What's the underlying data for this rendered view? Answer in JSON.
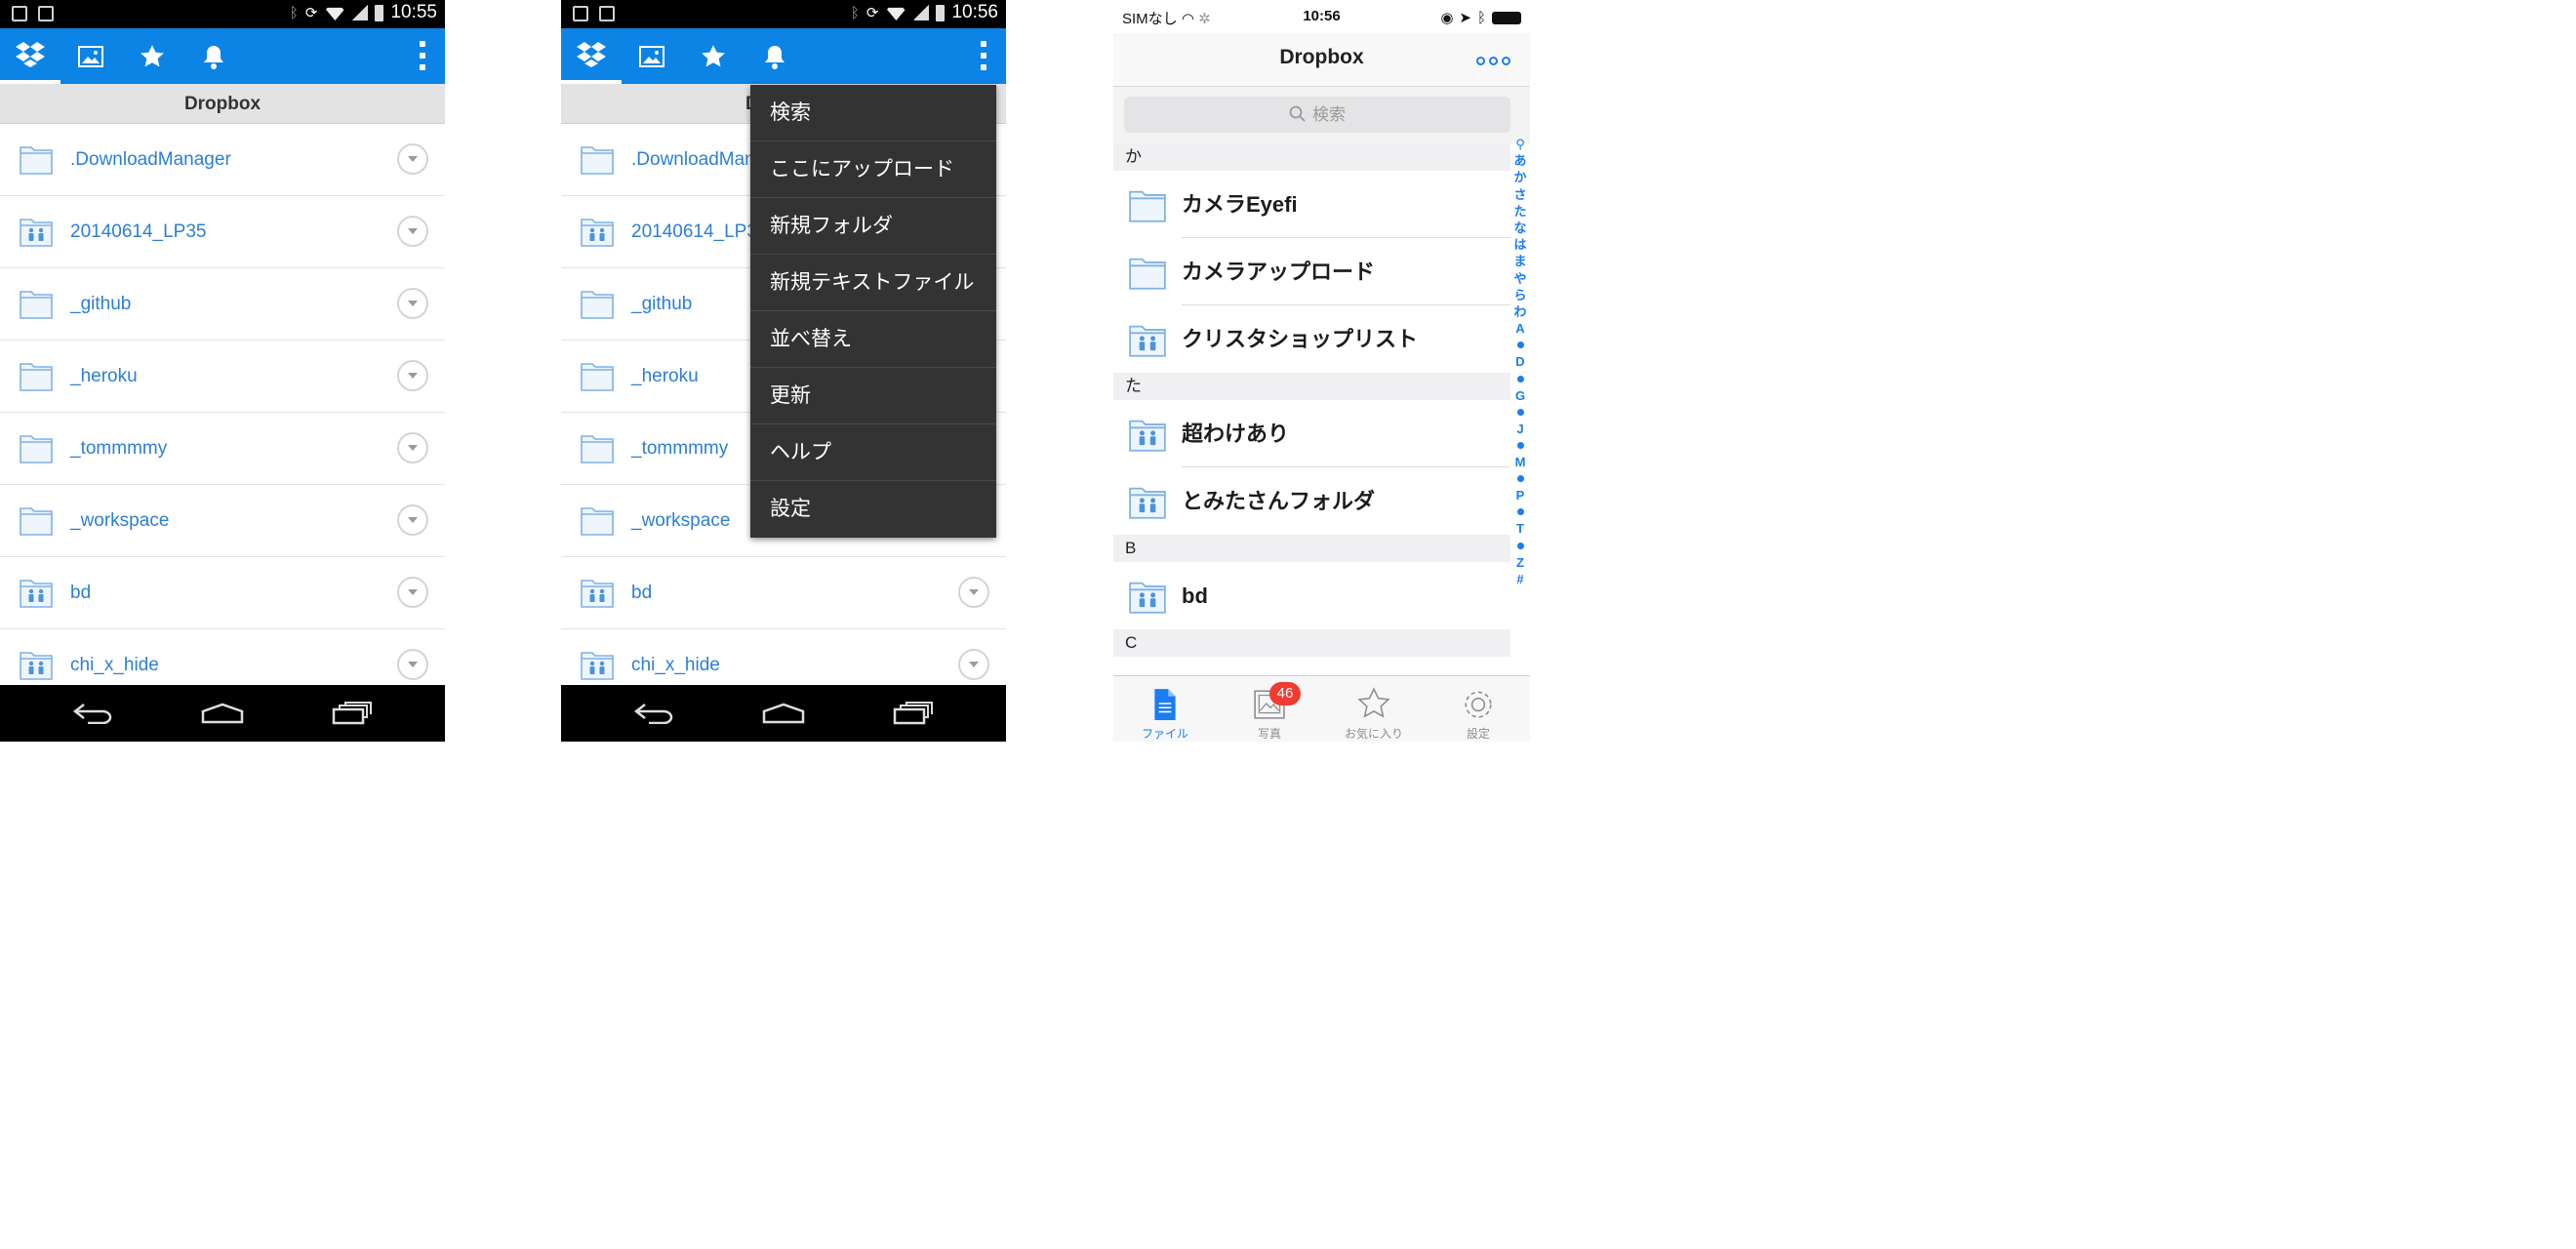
{
  "screens": {
    "android_list": {
      "status_time": "10:55",
      "breadcrumb": "Dropbox",
      "items": [
        {
          "name": ".DownloadManager",
          "icon": "folder-icon"
        },
        {
          "name": "20140614_LP35",
          "icon": "shared-folder-icon"
        },
        {
          "name": "_github",
          "icon": "folder-icon"
        },
        {
          "name": "_heroku",
          "icon": "folder-icon"
        },
        {
          "name": "_tommmmy",
          "icon": "folder-icon"
        },
        {
          "name": "_workspace",
          "icon": "folder-icon"
        },
        {
          "name": "bd",
          "icon": "shared-folder-icon"
        },
        {
          "name": "chi_x_hide",
          "icon": "shared-folder-icon"
        }
      ]
    },
    "android_menu": {
      "status_time": "10:56",
      "items": [
        {
          "name": ".DownloadManager",
          "icon": "folder-icon"
        },
        {
          "name": "20140614_LP35",
          "icon": "shared-folder-icon"
        },
        {
          "name": "_github",
          "icon": "folder-icon"
        },
        {
          "name": "_heroku",
          "icon": "folder-icon"
        },
        {
          "name": "_tommmmy",
          "icon": "folder-icon"
        },
        {
          "name": "_workspace",
          "icon": "folder-icon"
        },
        {
          "name": "bd",
          "icon": "shared-folder-icon"
        },
        {
          "name": "chi_x_hide",
          "icon": "shared-folder-icon"
        }
      ],
      "menu": [
        "検索",
        "ここにアップロード",
        "新規フォルダ",
        "新規テキストファイル",
        "並べ替え",
        "更新",
        "ヘルプ",
        "設定"
      ]
    },
    "ios": {
      "carrier": "SIMなし",
      "time": "10:56",
      "title": "Dropbox",
      "search_placeholder": "検索",
      "sections": [
        {
          "header": "か",
          "items": [
            {
              "name": "カメラEyefi",
              "icon": "folder-icon"
            },
            {
              "name": "カメラアップロード",
              "icon": "folder-icon"
            },
            {
              "name": "クリスタショップリスト",
              "icon": "shared-folder-icon"
            }
          ]
        },
        {
          "header": "た",
          "items": [
            {
              "name": "超わけあり",
              "icon": "shared-folder-icon"
            },
            {
              "name": "とみたさんフォルダ",
              "icon": "shared-folder-icon"
            }
          ]
        },
        {
          "header": "B",
          "items": [
            {
              "name": "bd",
              "icon": "shared-folder-icon"
            }
          ]
        },
        {
          "header": "C",
          "items": []
        }
      ],
      "index": [
        "あ",
        "か",
        "さ",
        "た",
        "な",
        "は",
        "ま",
        "や",
        "ら",
        "わ",
        "A",
        "D",
        "G",
        "J",
        "M",
        "P",
        "T",
        "Z",
        "#"
      ],
      "tabs": [
        {
          "label": "ファイル",
          "icon": "file-icon",
          "selected": true
        },
        {
          "label": "写真",
          "icon": "photo-icon",
          "badge": "46"
        },
        {
          "label": "お気に入り",
          "icon": "star-icon"
        },
        {
          "label": "設定",
          "icon": "gear-icon"
        }
      ]
    }
  },
  "colors": {
    "accent_blue": "#0b84e6",
    "ios_blue": "#1a7df1",
    "badge_red": "#f23b30",
    "menu_bg": "#333333"
  }
}
